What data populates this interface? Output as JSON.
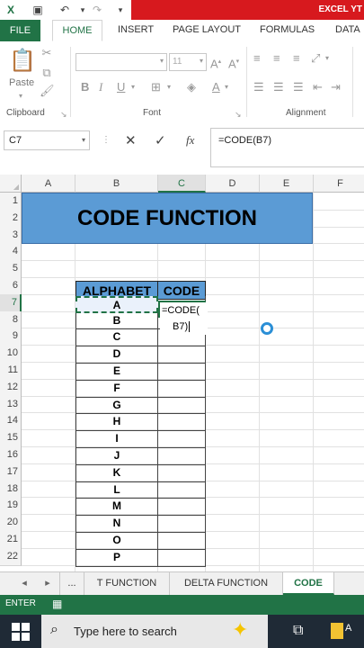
{
  "window": {
    "title": "EXCEL YT"
  },
  "ribbon": {
    "tabs": [
      "FILE",
      "HOME",
      "INSERT",
      "PAGE LAYOUT",
      "FORMULAS",
      "DATA"
    ],
    "active_tab": "HOME",
    "paste_label": "Paste",
    "groups": {
      "clipboard": "Clipboard",
      "font": "Font",
      "alignment": "Alignment"
    },
    "font_size": "11"
  },
  "formula_bar": {
    "name_box": "C7",
    "fx": "fx",
    "formula": "=CODE(B7)"
  },
  "columns": [
    "A",
    "B",
    "C",
    "D",
    "E",
    "F"
  ],
  "selected_column": "C",
  "rows": [
    "1",
    "2",
    "3",
    "4",
    "5",
    "6",
    "7",
    "8",
    "9",
    "10",
    "11",
    "12",
    "13",
    "14",
    "15",
    "16",
    "17",
    "18",
    "19",
    "20",
    "21",
    "22"
  ],
  "selected_row": "7",
  "banner_title": "CODE FUNCTION",
  "table": {
    "header_alphabet": "ALPHABET",
    "header_code": "CODE",
    "letters": [
      "A",
      "B",
      "C",
      "D",
      "E",
      "F",
      "G",
      "H",
      "I",
      "J",
      "K",
      "L",
      "M",
      "N",
      "O",
      "P"
    ]
  },
  "editing": {
    "line1": "=CODE(",
    "line2": "B7)"
  },
  "sheet_tabs": {
    "nav_prev": "◂",
    "nav_next": "▸",
    "more": "...",
    "items": [
      "T FUNCTION",
      "DELTA FUNCTION",
      "CODE"
    ],
    "active": "CODE"
  },
  "status": {
    "mode": "ENTER"
  },
  "taskbar": {
    "search_placeholder": "Type here to search"
  },
  "colors": {
    "excel_green": "#217346",
    "title_red": "#d7191e",
    "header_blue": "#5b9bd5"
  }
}
